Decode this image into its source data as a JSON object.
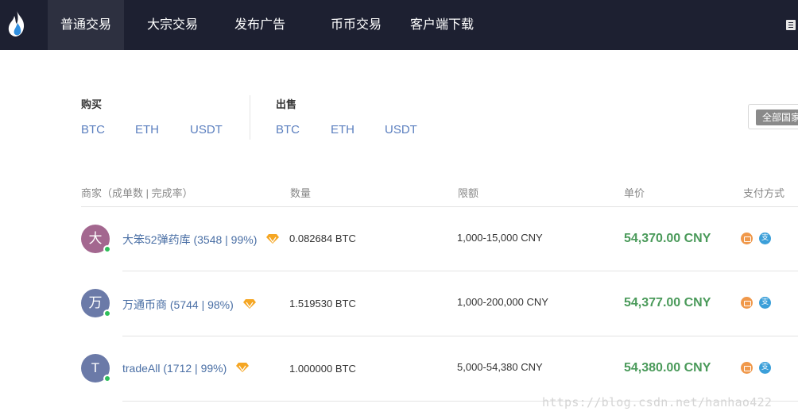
{
  "nav": {
    "items": [
      {
        "label": "普通交易",
        "active": true
      },
      {
        "label": "大宗交易",
        "active": false
      },
      {
        "label": "发布广告",
        "active": false
      },
      {
        "label": "币币交易",
        "active": false
      },
      {
        "label": "客户端下载",
        "active": false
      }
    ]
  },
  "trade": {
    "buy": {
      "title": "购买",
      "coins": [
        "BTC",
        "ETH",
        "USDT"
      ]
    },
    "sell": {
      "title": "出售",
      "coins": [
        "BTC",
        "ETH",
        "USDT"
      ]
    },
    "country_filter": "全部国家"
  },
  "table": {
    "headers": {
      "merchant": "商家（成单数 | 完成率）",
      "amount": "数量",
      "limit": "限额",
      "price": "单价",
      "payment": "支付方式"
    },
    "rows": [
      {
        "avatar": "大",
        "avatar_color": "#a3678f",
        "merchant": "大笨52弹药库 (3548 | 99%)",
        "amount": "0.082684 BTC",
        "limit": "1,000-15,000 CNY",
        "price": "54,370.00 CNY",
        "payments": [
          "bank-card",
          "alipay"
        ]
      },
      {
        "avatar": "万",
        "avatar_color": "#6b7aa8",
        "merchant": "万通币商 (5744 | 98%)",
        "amount": "1.519530 BTC",
        "limit": "1,000-200,000 CNY",
        "price": "54,377.00 CNY",
        "payments": [
          "bank-card",
          "alipay"
        ]
      },
      {
        "avatar": "T",
        "avatar_color": "#6b7aa8",
        "merchant": "tradeAll (1712 | 99%)",
        "amount": "1.000000 BTC",
        "limit": "5,000-54,380 CNY",
        "price": "54,380.00 CNY",
        "payments": [
          "bank-card",
          "alipay"
        ]
      }
    ]
  },
  "colors": {
    "nav_bg": "#1d2031",
    "link": "#5b7fbf",
    "price": "#4a9a5a",
    "online": "#2fbf5a",
    "badge": "#f5a623"
  },
  "icons": {
    "logo": "flame-logo-icon",
    "menu": "menu-icon",
    "badge": "diamond-badge-icon",
    "bank": "bank-card-icon",
    "alipay": "alipay-icon"
  },
  "watermark": "https://blog.csdn.net/hanhao422"
}
